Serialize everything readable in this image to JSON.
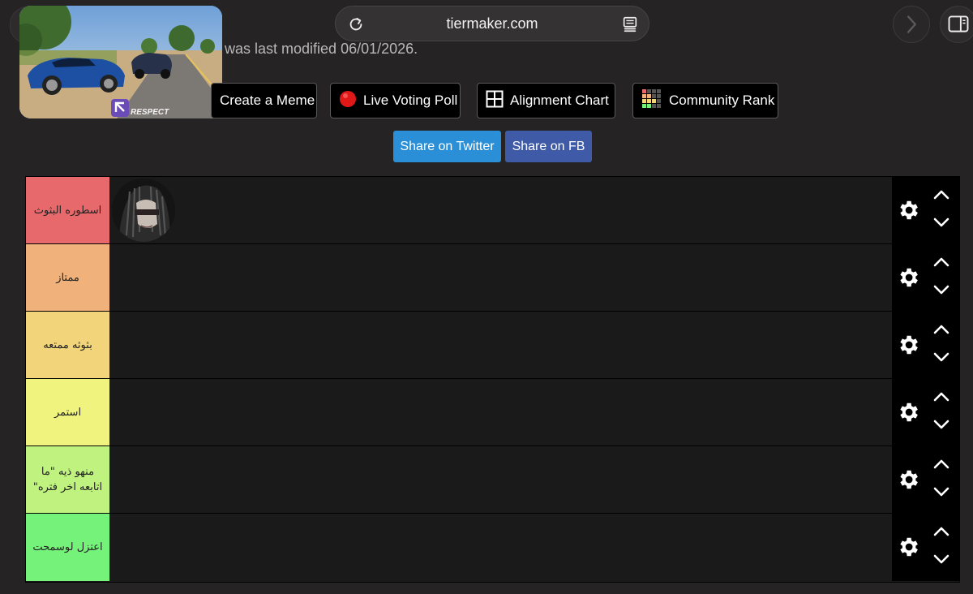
{
  "browser": {
    "url": "tiermaker.com"
  },
  "page": {
    "last_modified_partial": "d was last modified 06/01/2026."
  },
  "pip": {
    "watermark": "RESPECT"
  },
  "actions": [
    {
      "label": "Create a Meme"
    },
    {
      "label": "Live Voting Poll"
    },
    {
      "label": "Alignment Chart"
    },
    {
      "label": "Community Rank"
    }
  ],
  "share": {
    "twitter_label": "Share on Twitter",
    "fb_label": "Share on FB",
    "twitter_color": "#2b8fd7",
    "fb_color": "#3f5ba8"
  },
  "tiers": [
    {
      "label": "اسطوره البثوث",
      "color": "#e8696b"
    },
    {
      "label": "ممتاز",
      "color": "#f0b27a"
    },
    {
      "label": "بثوثه ممتعه",
      "color": "#f2d47b"
    },
    {
      "label": "استمر",
      "color": "#f1f37f"
    },
    {
      "label": "منهو ذيه \"ما اتابعه اخر فتره\"",
      "color": "#bff27e"
    },
    {
      "label": "اعتزل لوسمحت",
      "color": "#74f279"
    }
  ],
  "icons": {
    "reload": "reload-icon",
    "reader": "reader-icon",
    "forward": "chevron-right-icon",
    "tabs": "sidebar-icon",
    "gear": "gear-icon",
    "up": "chevron-up-icon",
    "down": "chevron-down-icon"
  }
}
